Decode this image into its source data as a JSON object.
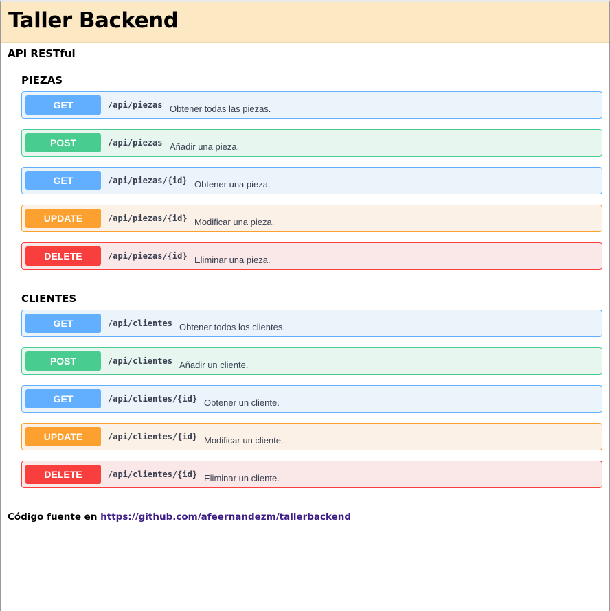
{
  "header": {
    "title": "Taller Backend"
  },
  "subtitle": "API RESTful",
  "sections": [
    {
      "title": "PIEZAS",
      "endpoints": [
        {
          "method": "GET",
          "path": "/api/piezas",
          "description": "Obtener todas las piezas."
        },
        {
          "method": "POST",
          "path": "/api/piezas",
          "description": "Añadir una pieza."
        },
        {
          "method": "GET",
          "path": "/api/piezas/{id}",
          "description": "Obtener una pieza."
        },
        {
          "method": "UPDATE",
          "path": "/api/piezas/{id}",
          "description": "Modificar una pieza."
        },
        {
          "method": "DELETE",
          "path": "/api/piezas/{id}",
          "description": "Eliminar una pieza."
        }
      ]
    },
    {
      "title": "CLIENTES",
      "endpoints": [
        {
          "method": "GET",
          "path": "/api/clientes",
          "description": "Obtener todos los clientes."
        },
        {
          "method": "POST",
          "path": "/api/clientes",
          "description": "Añadir un cliente."
        },
        {
          "method": "GET",
          "path": "/api/clientes/{id}",
          "description": "Obtener un cliente."
        },
        {
          "method": "UPDATE",
          "path": "/api/clientes/{id}",
          "description": "Modificar un cliente."
        },
        {
          "method": "DELETE",
          "path": "/api/clientes/{id}",
          "description": "Eliminar un cliente."
        }
      ]
    }
  ],
  "footer": {
    "prefix": "Código fuente en",
    "link_text": "https://github.com/afeernandezm/tallerbackend"
  },
  "colors": {
    "get": "#61affe",
    "post": "#49cc90",
    "update": "#fca130",
    "delete": "#f93e3e",
    "header_bg": "#fde8c4",
    "link": "#3d1d86"
  }
}
